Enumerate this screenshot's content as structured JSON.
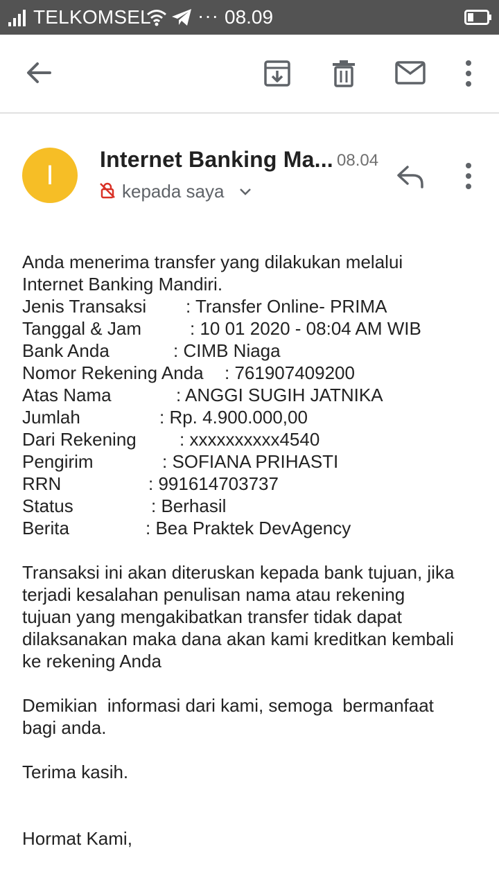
{
  "status_bar": {
    "carrier": "TELKOMSEL",
    "extra": "···",
    "time": "08.09",
    "icons": [
      "signal-icon",
      "wifi-icon",
      "telegram-icon",
      "battery-icon"
    ]
  },
  "app_bar": {
    "icons": [
      "back-arrow-icon",
      "archive-icon",
      "delete-icon",
      "mark-unread-icon",
      "more-vert-icon"
    ]
  },
  "header": {
    "avatar_letter": "I",
    "avatar_color": "#f6be26",
    "sender": "Internet Banking Ma...",
    "time": "08.04",
    "recipient": "kepada saya"
  },
  "body": {
    "intro": [
      "Anda menerima transfer yang dilakukan melalui",
      "Internet Banking Mandiri."
    ],
    "details": [
      {
        "key": "Jenis Transaksi",
        "value": ": Transfer Online- PRIMA"
      },
      {
        "key": "Tanggal & Jam",
        "value": ": 10 01 2020 - 08:04 AM WIB"
      },
      {
        "key": "Bank Anda",
        "value": ": CIMB Niaga"
      },
      {
        "key": "Nomor Rekening Anda",
        "value": ": 761907409200"
      },
      {
        "key": "Atas Nama",
        "value": ": ANGGI SUGIH JATNIKA"
      },
      {
        "key": "Jumlah",
        "value": ": Rp. 4.900.000,00"
      },
      {
        "key": "Dari Rekening",
        "value": ": xxxxxxxxxx4540"
      },
      {
        "key": "Pengirim",
        "value": ": SOFIANA PRIHASTI"
      },
      {
        "key": "RRN",
        "value": ": 991614703737"
      },
      {
        "key": "Status",
        "value": ": Berhasil"
      },
      {
        "key": "Berita",
        "value": ": Bea Praktek DevAgency"
      }
    ],
    "notice": [
      "Transaksi ini akan diteruskan kepada bank tujuan, jika",
      "terjadi kesalahan penulisan nama atau rekening",
      "tujuan yang mengakibatkan transfer tidak dapat",
      "dilaksanakan maka dana akan kami kreditkan kembali",
      "ke rekening Anda"
    ],
    "closing": [
      "Demikian  informasi dari kami, semoga  bermanfaat",
      "bagi anda."
    ],
    "thanks": "Terima kasih.",
    "signoff": "Hormat Kami,"
  }
}
